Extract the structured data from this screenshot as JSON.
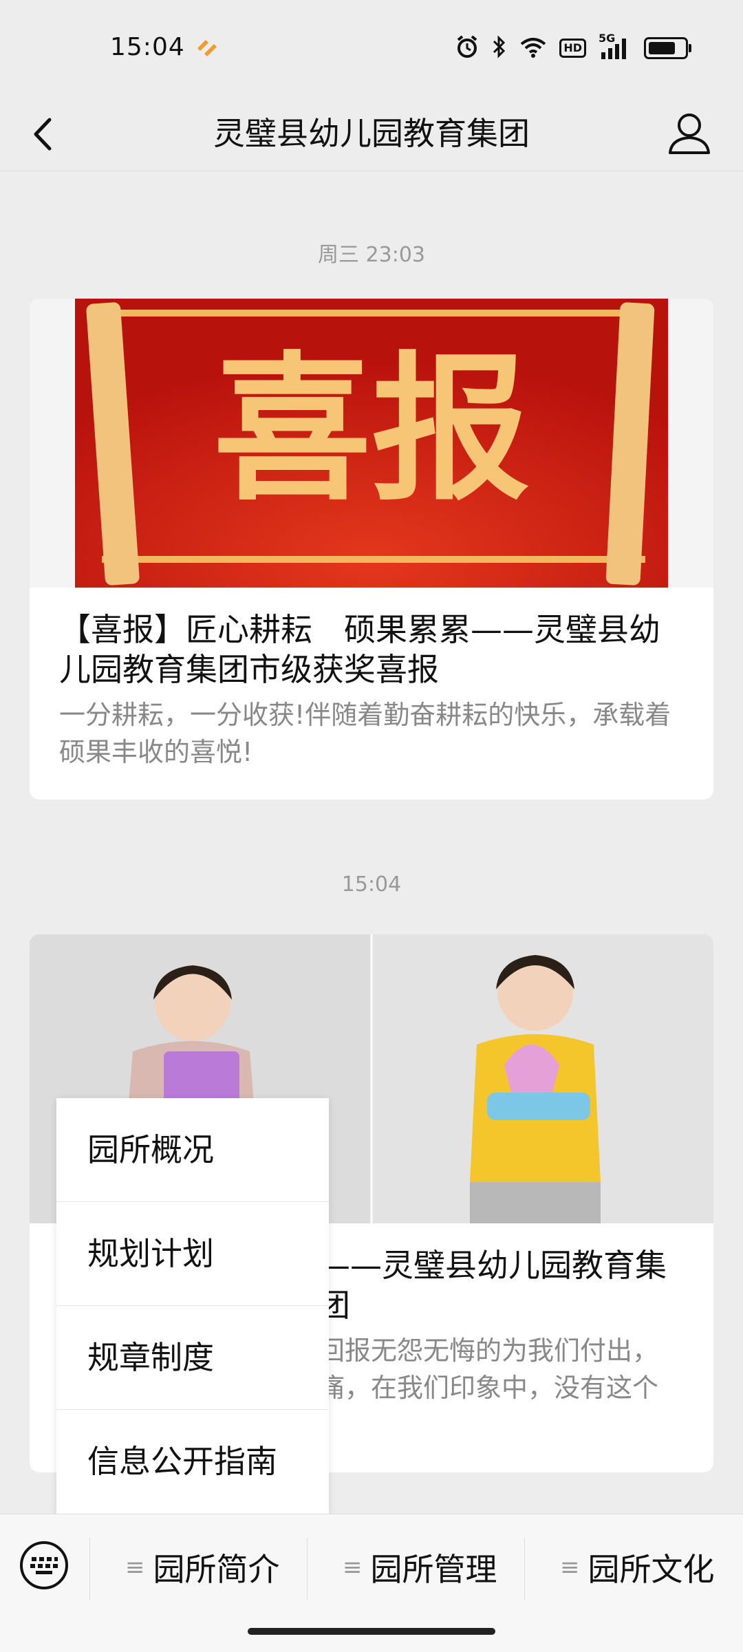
{
  "status_bar": {
    "time": "15:04",
    "icons": [
      "alarm-icon",
      "bluetooth-icon",
      "wifi-icon",
      "hd-icon",
      "signal-5g-icon",
      "battery-icon"
    ],
    "hd_label": "HD",
    "network_label": "5G"
  },
  "header": {
    "title": "灵璧县幼儿园教育集团",
    "back_icon": "chevron-left-icon",
    "profile_icon": "person-icon"
  },
  "messages": [
    {
      "timestamp": "周三 23:03",
      "cover_text": "喜报",
      "title": "【喜报】匠心耕耘　硕果累累——灵璧县幼儿园教育集团市级获奖喜报",
      "description": "一分耕耘，一分收获!伴随着勤奋耕耘的快乐，承载着硕果丰收的喜悦!"
    },
    {
      "timestamp": "15:04",
      "title": "——灵璧县幼儿园教育集团",
      "description_line1": "回报无怨无悔的为我们付出，",
      "description_line2": "痛，在我们印象中，没有这个"
    }
  ],
  "popup_menu": {
    "items": [
      "园所概况",
      "规划计划",
      "规章制度",
      "信息公开指南"
    ]
  },
  "bottom_menu": {
    "keyboard_icon": "keyboard-icon",
    "tabs": [
      "园所简介",
      "园所管理",
      "园所文化"
    ]
  },
  "colors": {
    "background": "#ededed",
    "card": "#ffffff",
    "banner_red": "#d4231c",
    "banner_gold": "#f6c676"
  }
}
